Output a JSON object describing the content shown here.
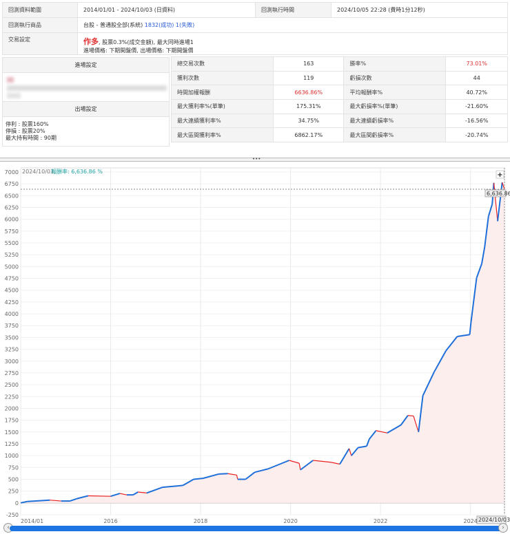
{
  "info": {
    "range_label": "回測資料範圍",
    "range_value": "2014/01/01 - 2024/10/03 (日資料)",
    "time_label": "回測執行時間",
    "time_value": "2024/10/05 22:28 (費時1分12秒)",
    "product_label": "回測執行商品",
    "product_value": "台股 - 普通股全部(系統)",
    "product_success": "1832(成功)",
    "product_fail": "1(失敗)",
    "trade_label": "交易設定",
    "trade_direction": "作多",
    "trade_fee": ", 股票0.3%(成交金額), 最大同時進場1",
    "trade_prices": "進場價格: 下期開盤價, 出場價格: 下期開盤價"
  },
  "entry": {
    "header": "進場設定"
  },
  "exit": {
    "header": "出場設定",
    "lines": [
      "停利 : 股票160%",
      "停損 : 股票20%",
      "最大持有時間 : 90期"
    ]
  },
  "stats": [
    [
      "總交易次數",
      "163",
      "勝率%",
      "73.01%"
    ],
    [
      "獲利次數",
      "119",
      "虧損次數",
      "44"
    ],
    [
      "時間加權報酬",
      "6636.86%",
      "平均報酬率%",
      "40.72%"
    ],
    [
      "最大獲利率%(單筆)",
      "175.31%",
      "最大虧損率%(單筆)",
      "-21.60%"
    ],
    [
      "最大連續獲利率%",
      "34.75%",
      "最大連續虧損率%",
      "-16.56%"
    ],
    [
      "最大區間獲利率%",
      "6862.17%",
      "最大區間虧損率%",
      "-20.74%"
    ]
  ],
  "colors": {
    "up": "#1e6fd9",
    "down": "#e82020",
    "fill": "#fdeeee",
    "highlight": "#e03030",
    "link": "#2a5bd7",
    "tooltip": "#2aa6a6"
  },
  "chart_data": {
    "type": "line",
    "tooltip_date": "2024/10/03",
    "tooltip_label": "報酬率: 6,636.86 %",
    "last_value_label": "6,636.86",
    "last_date_label": "2024/10/03",
    "ylim": [
      -250,
      7000
    ],
    "yticks": [
      -250,
      0,
      250,
      500,
      750,
      1000,
      1250,
      1500,
      1750,
      2000,
      2250,
      2500,
      2750,
      3000,
      3250,
      3500,
      3750,
      4000,
      4250,
      4500,
      4750,
      5000,
      5250,
      5500,
      5750,
      6000,
      6250,
      6500,
      6750,
      7000
    ],
    "xticks": [
      "2014/01",
      "2016",
      "2018",
      "2020",
      "2022",
      "2024"
    ],
    "grid": true,
    "points": [
      [
        "2014/01/01",
        0
      ],
      [
        "2014/02/25",
        30
      ],
      [
        "2014/08/25",
        60
      ],
      [
        "2014/11/25",
        40
      ],
      [
        "2015/02/05",
        40
      ],
      [
        "2015/04/01",
        90
      ],
      [
        "2015/07/01",
        150
      ],
      [
        "2016/01/01",
        140
      ],
      [
        "2016/03/15",
        200
      ],
      [
        "2016/05/10",
        170
      ],
      [
        "2016/07/01",
        170
      ],
      [
        "2016/08/10",
        230
      ],
      [
        "2016/10/20",
        210
      ],
      [
        "2017/02/25",
        330
      ],
      [
        "2017/08/10",
        370
      ],
      [
        "2017/11/05",
        500
      ],
      [
        "2018/01/20",
        520
      ],
      [
        "2018/05/25",
        610
      ],
      [
        "2018/08/10",
        620
      ],
      [
        "2018/10/20",
        590
      ],
      [
        "2018/10/28",
        500
      ],
      [
        "2019/01/01",
        500
      ],
      [
        "2019/03/15",
        650
      ],
      [
        "2019/07/01",
        720
      ],
      [
        "2019/12/20",
        900
      ],
      [
        "2020/03/10",
        840
      ],
      [
        "2020/03/20",
        700
      ],
      [
        "2020/07/01",
        900
      ],
      [
        "2020/11/25",
        860
      ],
      [
        "2021/02/05",
        820
      ],
      [
        "2021/04/20",
        1150
      ],
      [
        "2021/05/08",
        1000
      ],
      [
        "2021/07/01",
        1170
      ],
      [
        "2021/09/10",
        1200
      ],
      [
        "2021/10/01",
        1350
      ],
      [
        "2021/11/25",
        1530
      ],
      [
        "2022/02/25",
        1480
      ],
      [
        "2022/06/15",
        1650
      ],
      [
        "2022/08/10",
        1850
      ],
      [
        "2022/09/25",
        1840
      ],
      [
        "2022/11/05",
        1500
      ],
      [
        "2022/12/10",
        2270
      ],
      [
        "2023/03/10",
        2770
      ],
      [
        "2023/06/15",
        3220
      ],
      [
        "2023/09/15",
        3520
      ],
      [
        "2023/12/25",
        3560
      ],
      [
        "2024/01/05",
        3820
      ],
      [
        "2024/02/20",
        4760
      ],
      [
        "2024/04/01",
        5060
      ],
      [
        "2024/04/25",
        5420
      ],
      [
        "2024/05/25",
        6060
      ],
      [
        "2024/06/25",
        6320
      ],
      [
        "2024/07/08",
        6770
      ],
      [
        "2024/08/08",
        5960
      ],
      [
        "2024/09/15",
        6780
      ],
      [
        "2024/10/03",
        6636.86
      ]
    ]
  }
}
